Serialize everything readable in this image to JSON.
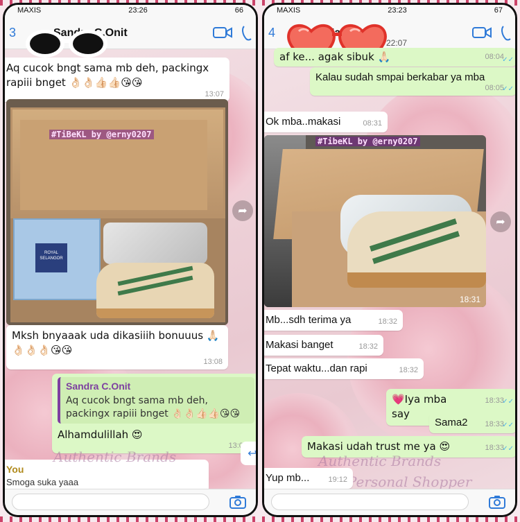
{
  "colors": {
    "accent": "#2f7ad8",
    "out_bubble": "#dcf8c6",
    "in_bubble": "#ffffff",
    "quote_bar": "#7d3fa0",
    "check": "#4fb3e8"
  },
  "left": {
    "status": {
      "carrier": "MAXIS",
      "time": "23:26",
      "battery": "66"
    },
    "header": {
      "back": "3",
      "name": "Sandra C.Onit"
    },
    "messages": [
      {
        "text": "Aq cucok bngt sama mb deh, packingx rapiii bnget 👌🏻👌🏻👍🏻👍🏻😘😘",
        "time": "13:07"
      },
      {
        "watermark": "#TiBeKL by @erny0207",
        "box_label": "ROYAL SELANGOR"
      },
      {
        "text": "Mksh bnyaaak uda dikasiiih bonuuus 🙏🏻 👌🏻👌🏻👌🏻😘😘",
        "time": "13:08"
      },
      {
        "quote_name": "Sandra C.Onit",
        "quote_text": "Aq cucok bngt sama mb deh, packingx rapiii bnget 👌🏻👌🏻👍🏻👍🏻😘😘",
        "text": "Alhamdulillah 😍",
        "time": "13:09"
      },
      {
        "sender": "You",
        "text": "Smoga suka yaaa"
      }
    ],
    "brand": "Authentic Brands"
  },
  "right": {
    "status": {
      "carrier": "MAXIS",
      "time": "23:23",
      "battery": "67"
    },
    "header": {
      "back": "4",
      "name": "Mario",
      "subtitle": "22:07"
    },
    "messages": [
      {
        "text": "af ke... agak sibuk 🙏🏻",
        "time": "08:04"
      },
      {
        "text": "Kalau sudah smpai berkabar ya mba",
        "time": "08:05"
      },
      {
        "text": "Ok mba..makasi",
        "time": "08:31"
      },
      {
        "watermark": "#TibeKL by @erny0207",
        "time": "18:31"
      },
      {
        "text": "Mb...sdh terima ya",
        "time": "18:32"
      },
      {
        "text": "Makasi banget",
        "time": "18:32"
      },
      {
        "text": "Tepat waktu...dan rapi",
        "time": "18:32"
      },
      {
        "text": "💗Iya mba say",
        "time": "18:33"
      },
      {
        "text": "Sama2",
        "time": "18:33"
      },
      {
        "text": "Makasi udah trust me ya 😍",
        "time": "18:33"
      },
      {
        "text": "Yup mb...",
        "time": "19:12"
      }
    ],
    "brand_1": "Authentic Brands",
    "brand_2": "Personal Shopper"
  }
}
